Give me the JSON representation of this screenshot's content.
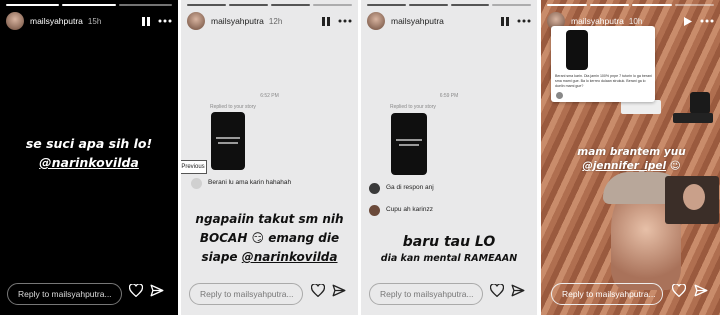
{
  "panels": [
    {
      "username": "mailsyahputra",
      "time": "15h",
      "text_line1": "se suci apa sih lo!",
      "mention": "@narinkovilda",
      "reply_placeholder": "Reply to mailsyahputra...",
      "icons": [
        "pause-icon",
        "more-icon",
        "heart-icon",
        "send-icon"
      ]
    },
    {
      "username": "mailsyahputra",
      "time": "12h",
      "timestamp": "6:52 PM",
      "replied_label": "Replied to your story",
      "previous_label": "Previous",
      "comment": "Berani lu ama karin hahahah",
      "caption_line1": "ngapaiin takut sm nih",
      "caption_line2": "BOCAH 😏 emang die",
      "caption_line3_prefix": "siape ",
      "caption_mention": "@narinkovilda",
      "reply_placeholder": "Reply to mailsyahputra...",
      "icons": [
        "pause-icon",
        "more-icon",
        "heart-icon",
        "send-icon"
      ]
    },
    {
      "username": "mailsyahputra",
      "time": "",
      "timestamp": "6:59 PM",
      "replied_label": "Replied to your story",
      "comments": [
        "Ga di respon anj",
        "Cupu ah karinzz"
      ],
      "caption_line1": "baru tau LO",
      "caption_line2": "dia kan mental RAMEAAN",
      "reply_placeholder": "Reply to mailsyahputra...",
      "icons": [
        "pause-icon",
        "more-icon",
        "heart-icon",
        "send-icon"
      ]
    },
    {
      "username": "mailsyahputra",
      "time": "10h",
      "embedded_text": "Berani sma karin. Dia jamin 100% pnpe 7 tutorin lo ga berani sma mami gue. Ba lo kerreo dulaan strukuk. Berani ga lo duelin mami gue?",
      "caption_line1": "mam brantem yuu",
      "caption_mention": "@jennifer_ipel",
      "reply_placeholder": "Reply to mailsyahputra...",
      "icons": [
        "play-icon",
        "more-icon",
        "heart-icon",
        "send-icon"
      ]
    }
  ],
  "colors": {
    "mention": "#ffffff",
    "purple_caption": "#4a3d8f",
    "dark_panel": "#000000",
    "light_panel": "#e9e9ea"
  }
}
